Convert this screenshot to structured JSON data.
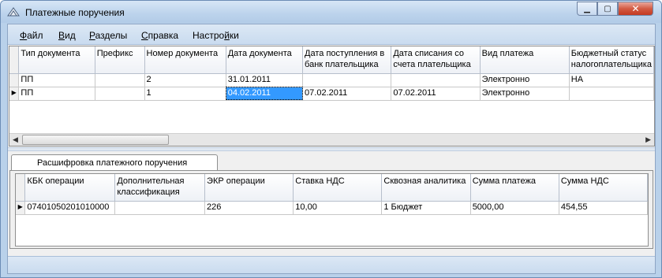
{
  "window": {
    "title": "Платежные поручения"
  },
  "menu": [
    {
      "pre": "",
      "u": "Ф",
      "post": "айл"
    },
    {
      "pre": "",
      "u": "В",
      "post": "ид"
    },
    {
      "pre": "",
      "u": "Р",
      "post": "азделы"
    },
    {
      "pre": "",
      "u": "С",
      "post": "правка"
    },
    {
      "pre": "Настро",
      "u": "й",
      "post": "ки"
    }
  ],
  "orders": {
    "columns": [
      "Тип документа",
      "Префикс",
      "Номер документа",
      "Дата документа",
      "Дата поступления в банк плательщика",
      "Дата списания со счета плательщика",
      "Вид платежа",
      "Бюджетный статус налогоплательщика"
    ],
    "rows": [
      [
        "ПП",
        "",
        "2",
        "31.01.2011",
        "",
        "",
        "Электронно",
        "НА"
      ],
      [
        "ПП",
        "",
        "1",
        "04.02.2011",
        "07.02.2011",
        "07.02.2011",
        "Электронно",
        ""
      ]
    ]
  },
  "details_tab": {
    "label": "Расшифровка платежного поручения"
  },
  "details": {
    "columns": [
      "КБК операции",
      "Дополнительная классификация",
      "ЭКР операции",
      "Ставка НДС",
      "Сквозная аналитика",
      "Сумма платежа",
      "Сумма НДС"
    ],
    "rows": [
      [
        "07401050201010000",
        "",
        "226",
        "10,00",
        "1 Бюджет",
        "5000,00",
        "454,55"
      ]
    ]
  }
}
